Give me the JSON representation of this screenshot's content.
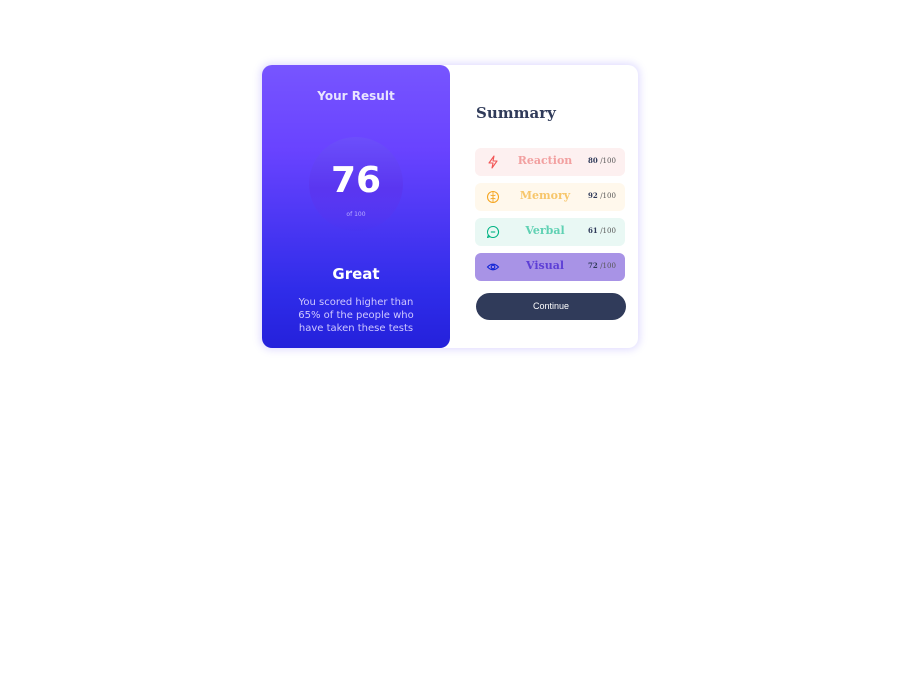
{
  "result": {
    "title": "Your Result",
    "score": "76",
    "score_of": "of 100",
    "rating": "Great",
    "description": "You scored higher than 65% of the people who have taken these tests"
  },
  "summary": {
    "title": "Summary",
    "items": [
      {
        "label": "Reaction",
        "score": "80",
        "max": "/100",
        "icon": "lightning-icon",
        "bg": "#fdf0f0",
        "color": "#f2a0a0"
      },
      {
        "label": "Memory",
        "score": "92",
        "max": "/100",
        "icon": "brain-icon",
        "bg": "#fff8ec",
        "color": "#f7c66a"
      },
      {
        "label": "Verbal",
        "score": "61",
        "max": "/100",
        "icon": "chat-bubble-icon",
        "bg": "#e9f8f4",
        "color": "#5fd1b3"
      },
      {
        "label": "Visual",
        "score": "72",
        "max": "/100",
        "icon": "eye-icon",
        "bg": "#a893e6",
        "color": "#5d3fd6"
      }
    ],
    "button_label": "Continue"
  },
  "colors": {
    "gradient_top": "#7755ff",
    "gradient_bottom": "#2421db",
    "button": "#303b5a"
  }
}
